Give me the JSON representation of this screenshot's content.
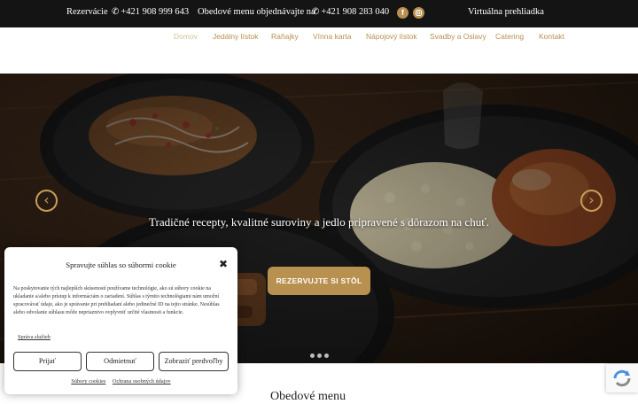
{
  "topbar": {
    "reservations_label": "Rezervácie",
    "reservations_phone": "+421 908 999 643",
    "lunch_label": "Obedové menu objednávajte na",
    "lunch_phone": "+421 908 283 040",
    "facebook_icon": "facebook-icon",
    "instagram_icon": "instagram-icon",
    "virtual_tour": "Virtuálna prehliadka"
  },
  "nav": {
    "items": [
      "Domov",
      "Jedálny lístok",
      "Raňajky",
      "Vínna karta",
      "Nápojový lístok",
      "Svadby a Oslavy",
      "Catering",
      "Kontakt"
    ],
    "active": "Domov"
  },
  "hero": {
    "tagline": "Tradičné recepty, kvalitné suroviny a jedlo pripravené s dôrazom na chuť.",
    "cta": "REZERVUJTE SI STÔL",
    "prev_icon": "chevron-left-icon",
    "next_icon": "chevron-right-icon",
    "slides": 3,
    "current_slide": 1
  },
  "cookie": {
    "title": "Spravujte súhlas so súbormi cookie",
    "text": "Na poskytovanie tých najlepších skúseností používame technológie, ako sú súbory cookie na ukladanie a/alebo prístup k informáciám o zariadení. Súhlas s týmito technológiami nám umožní spracovávať údaje, ako je správanie pri prehliadaní alebo jedinečné ID na tejto stránke. Nesúhlas alebo odvolanie súhlasu môže nepriaznivo ovplyvniť určité vlastnosti a funkcie.",
    "manage": "Správa služieb",
    "accept": "Prijať",
    "deny": "Odmietnuť",
    "preferences": "Zobraziť predvoľby",
    "link_cookies": "Súbory cookies",
    "link_privacy": "Ochrana osobných údajov"
  },
  "section": {
    "title": "Obedové menu"
  },
  "colors": {
    "accent": "#b8904f",
    "topbar": "#141414",
    "nav_active": "#d8c29a"
  }
}
